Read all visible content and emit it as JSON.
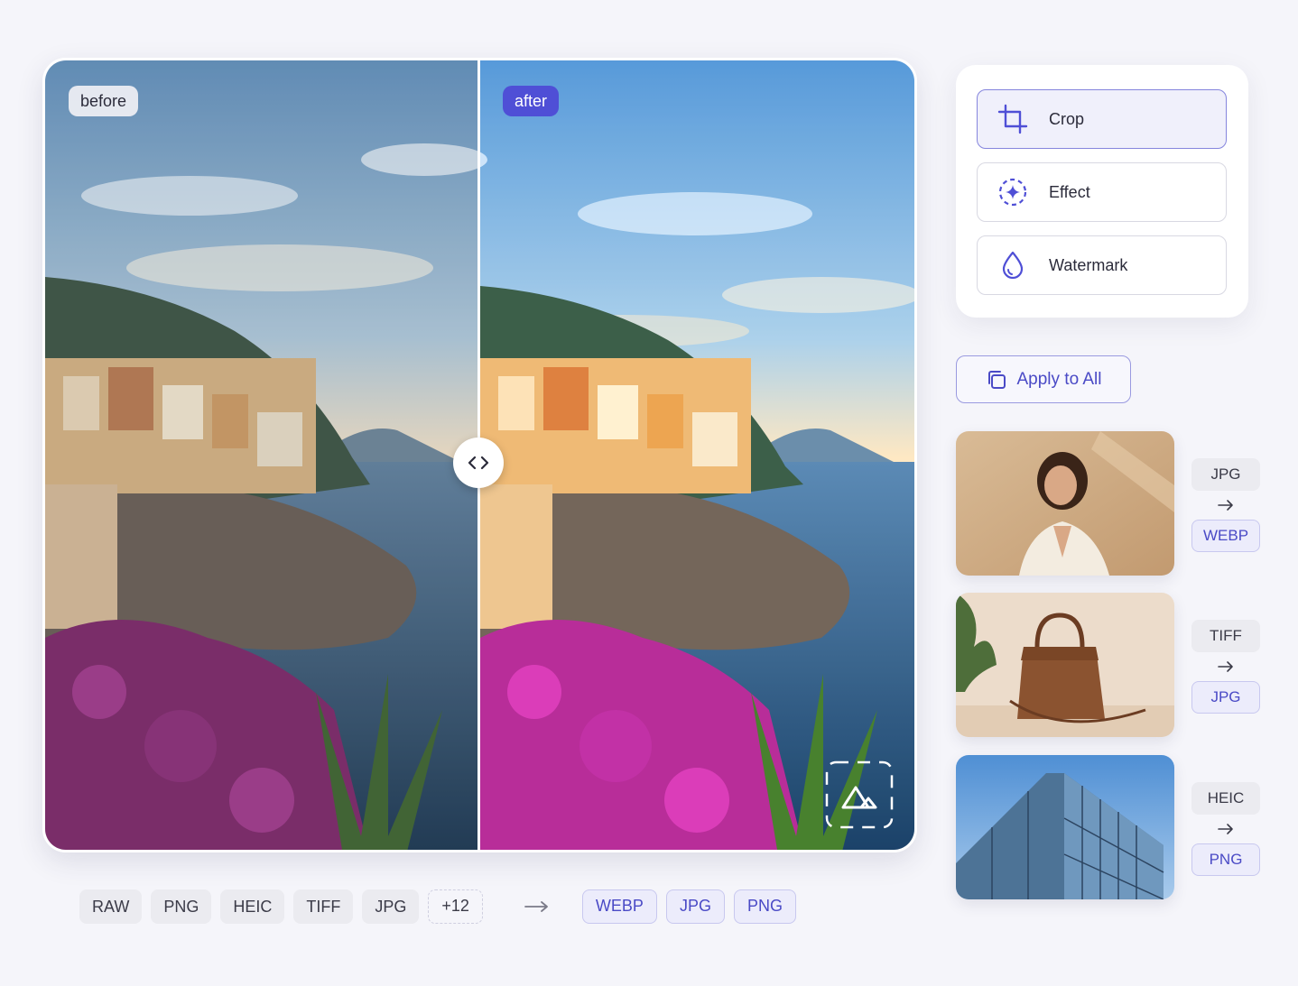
{
  "viewer": {
    "before_label": "before",
    "after_label": "after",
    "handle_icon": "chevrons-left-right-icon",
    "corner_icon": "image-placeholder-icon"
  },
  "formats": {
    "source": [
      "RAW",
      "PNG",
      "HEIC",
      "TIFF",
      "JPG"
    ],
    "more": "+12",
    "target": [
      "WEBP",
      "JPG",
      "PNG"
    ]
  },
  "tools": [
    {
      "label": "Crop",
      "icon": "crop-icon",
      "active": true
    },
    {
      "label": "Effect",
      "icon": "sparkle-effect-icon",
      "active": false
    },
    {
      "label": "Watermark",
      "icon": "water-drop-icon",
      "active": false
    }
  ],
  "apply_all": {
    "label": "Apply to All",
    "icon": "copy-icon"
  },
  "conversions": [
    {
      "from": "JPG",
      "to": "WEBP",
      "thumb": "portrait-woman"
    },
    {
      "from": "TIFF",
      "to": "JPG",
      "thumb": "handbag"
    },
    {
      "from": "HEIC",
      "to": "PNG",
      "thumb": "glass-building"
    }
  ],
  "colors": {
    "accent": "#4f4fd6",
    "accent_text": "#4a4ac6",
    "background": "#f5f5fa"
  }
}
